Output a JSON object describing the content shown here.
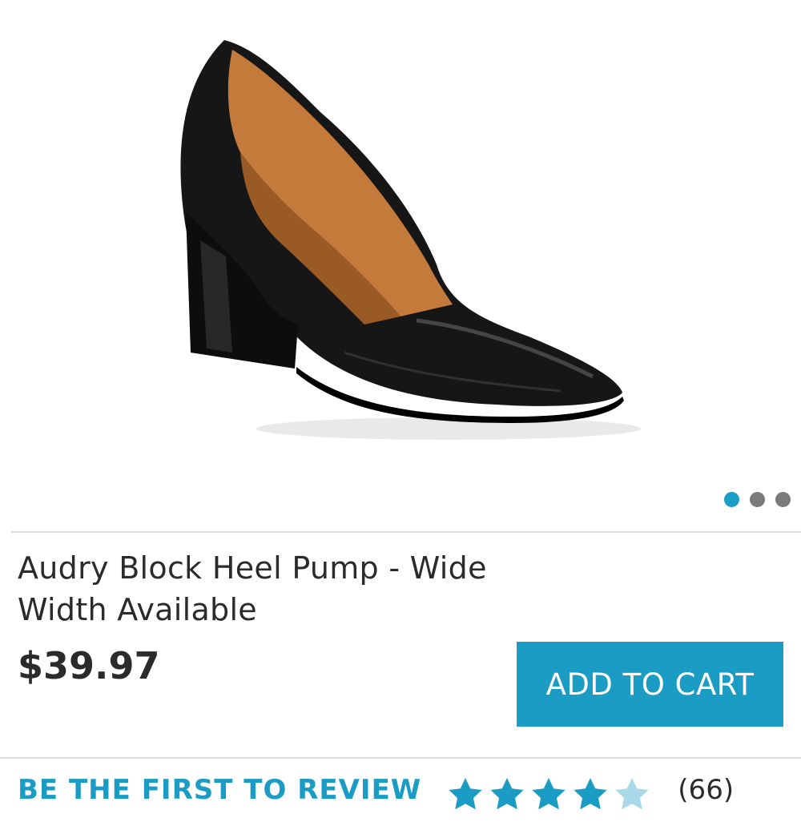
{
  "product": {
    "title": "Audry Block Heel Pump - Wide Width Available",
    "price": "$39.97",
    "image_icon": "black-patent-pump-image"
  },
  "gallery": {
    "page_count": 3,
    "active_index": 0
  },
  "actions": {
    "add_to_cart_label": "ADD TO CART"
  },
  "reviews": {
    "link_label": "BE THE FIRST TO REVIEW",
    "rating": 4,
    "rating_max": 5,
    "count_label": "(66)"
  },
  "colors": {
    "accent": "#1a9cc4",
    "star_filled": "#1a9cc4",
    "star_empty": "#a9d9e8",
    "dot_inactive": "#7a7a7a",
    "text": "#2b2b2b"
  }
}
